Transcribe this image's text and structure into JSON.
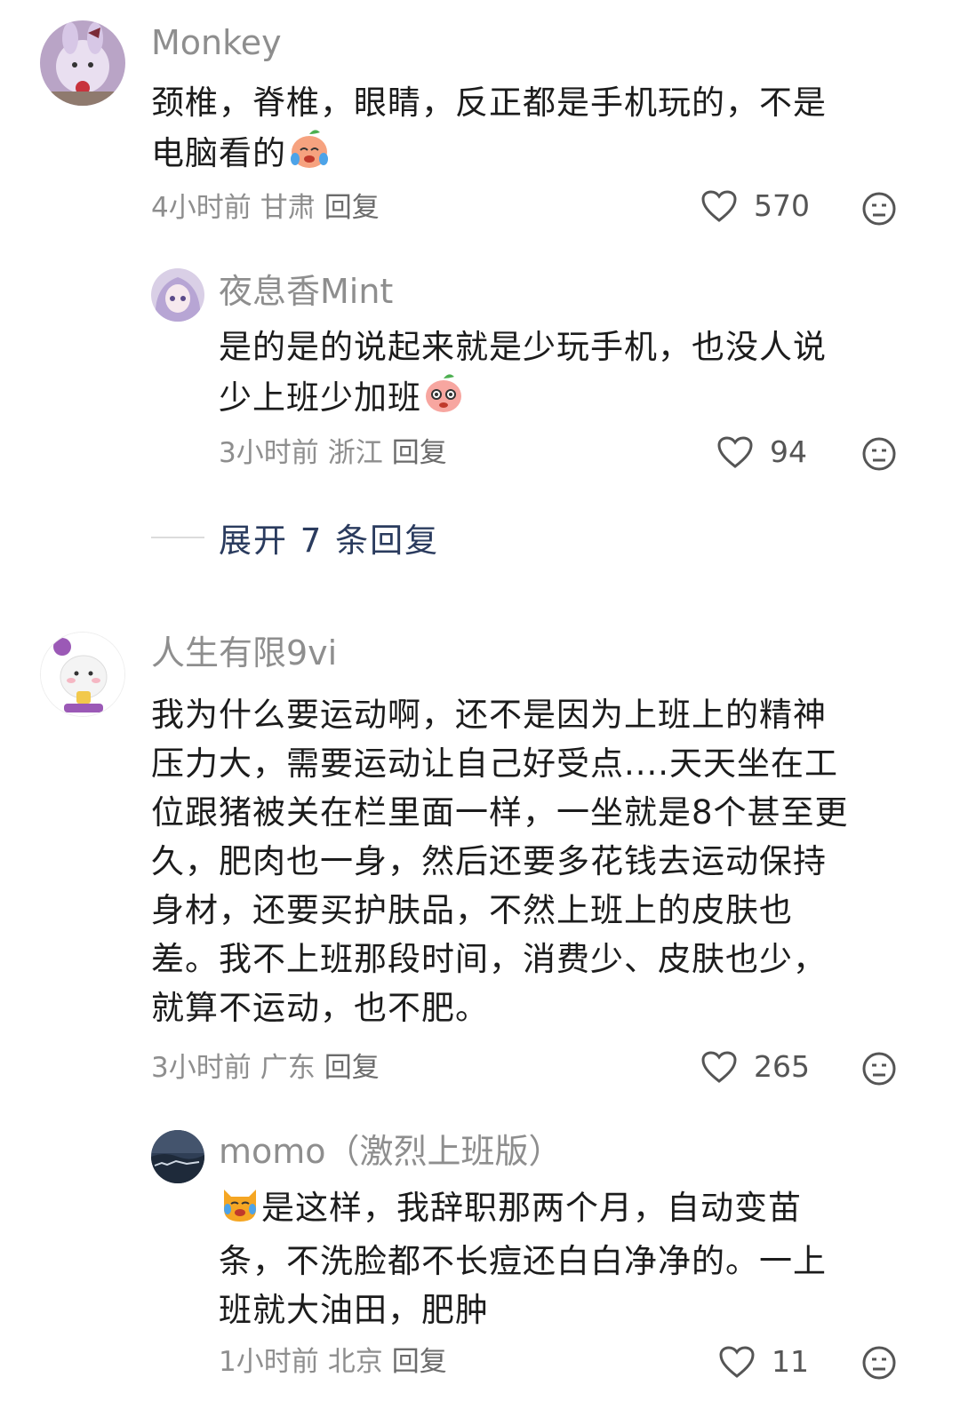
{
  "comments": [
    {
      "name": "Monkey",
      "text_lines": [
        "颈椎，脊椎，眼睛，反正都是手机玩的，不是",
        "电脑看的"
      ],
      "emoji": "crying-peach-emoji",
      "time": "4小时前",
      "location": "甘肃",
      "reply_label": "回复",
      "likes": "570"
    },
    {
      "name": "夜息香Mint",
      "text_lines": [
        "是的是的说起来就是少玩手机，也没人说",
        "少上班少加班"
      ],
      "emoji": "pleading-peach-emoji",
      "time": "3小时前",
      "location": "浙江",
      "reply_label": "回复",
      "likes": "94"
    },
    {
      "name": "人生有限9vi",
      "text_lines": [
        "我为什么要运动啊，还不是因为上班上的精神",
        "压力大，需要运动让自己好受点....天天坐在工",
        "位跟猪被关在栏里面一样，一坐就是8个甚至更",
        "久，肥肉也一身，然后还要多花钱去运动保持",
        "身材，还要买护肤品，不然上班上的皮肤也",
        "差。我不上班那段时间，消费少、皮肤也少，",
        "就算不运动，也不肥。"
      ],
      "time": "3小时前",
      "location": "广东",
      "reply_label": "回复",
      "likes": "265"
    },
    {
      "name": "momo（激烈上班版）",
      "emoji": "crying-cat-emoji",
      "text_lines": [
        "是这样，我辞职那两个月，自动变苗",
        "条，不洗脸都不长痘还白白净净的。一上",
        "班就大油田，肥肿"
      ],
      "time": "1小时前",
      "location": "北京",
      "reply_label": "回复",
      "likes": "11"
    }
  ],
  "expand_replies": "展开 7 条回复",
  "colors": {
    "name": "#8e8e8e",
    "text": "#1c1c1c",
    "meta": "#8e8e8e",
    "expand": "#2a3b5e"
  }
}
